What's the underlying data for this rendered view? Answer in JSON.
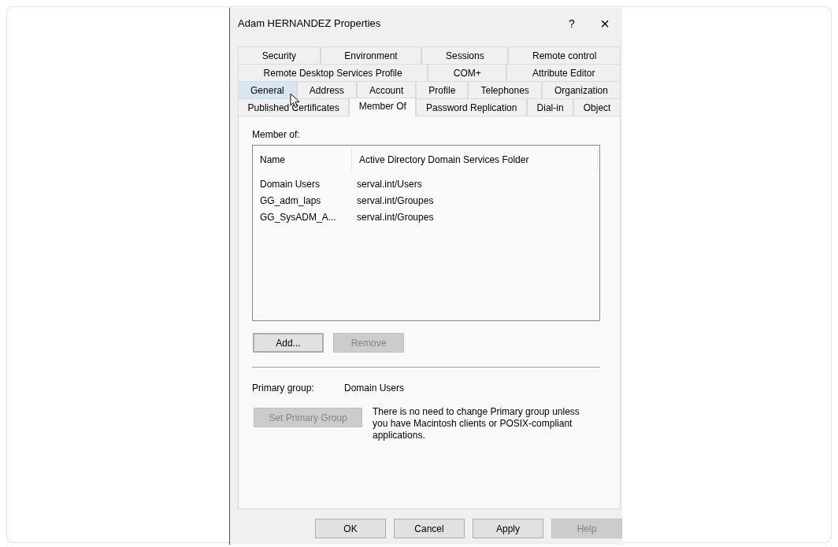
{
  "window": {
    "title": "Adam HERNANDEZ Properties",
    "title_buttons": [
      "?",
      "×"
    ]
  },
  "tab_rows": [
    [
      {
        "label": "Security",
        "selected": false,
        "hovered": false
      },
      {
        "label": "Environment",
        "selected": false,
        "hovered": false
      },
      {
        "label": "Sessions",
        "selected": false,
        "hovered": false
      },
      {
        "label": "Remote control",
        "selected": false,
        "hovered": false
      }
    ],
    [
      {
        "label": "Remote Desktop Services Profile",
        "selected": false,
        "hovered": false
      },
      {
        "label": "COM+",
        "selected": false,
        "hovered": false
      },
      {
        "label": "Attribute Editor",
        "selected": false,
        "hovered": false
      }
    ],
    [
      {
        "label": "General",
        "selected": false,
        "hovered": true
      },
      {
        "label": "Address",
        "selected": false,
        "hovered": false
      },
      {
        "label": "Account",
        "selected": false,
        "hovered": false
      },
      {
        "label": "Profile",
        "selected": false,
        "hovered": false
      },
      {
        "label": "Telephones",
        "selected": false,
        "hovered": false
      },
      {
        "label": "Organization",
        "selected": false,
        "hovered": false
      }
    ],
    [
      {
        "label": "Published Certificates",
        "selected": false,
        "hovered": false
      },
      {
        "label": "Member Of",
        "selected": true,
        "hovered": false
      },
      {
        "label": "Password Replication",
        "selected": false,
        "hovered": false
      },
      {
        "label": "Dial-in",
        "selected": false,
        "hovered": false
      },
      {
        "label": "Object",
        "selected": false,
        "hovered": false
      }
    ]
  ],
  "member_of": {
    "label": "Member of:",
    "columns": [
      "Name",
      "Active Directory Domain Services Folder"
    ],
    "rows": [
      [
        "Domain Users",
        "serval.int/Users"
      ],
      [
        "GG_adm_laps",
        "serval.int/Groupes"
      ],
      [
        "GG_SysADM_A...",
        "serval.int/Groupes"
      ]
    ],
    "buttons": [
      {
        "label": "Add...",
        "disabled": false,
        "default": true
      },
      {
        "label": "Remove",
        "disabled": true,
        "default": false
      }
    ]
  },
  "primary_group": {
    "label": "Primary group:",
    "value": "Domain Users",
    "button": {
      "label": "Set Primary Group",
      "disabled": true
    },
    "note": "There is no need to change Primary group unless you have Macintosh clients or POSIX-compliant applications."
  },
  "footer_buttons": [
    {
      "label": "OK",
      "disabled": false
    },
    {
      "label": "Cancel",
      "disabled": false
    },
    {
      "label": "Apply",
      "disabled": false
    },
    {
      "label": "Help",
      "disabled": true
    }
  ]
}
